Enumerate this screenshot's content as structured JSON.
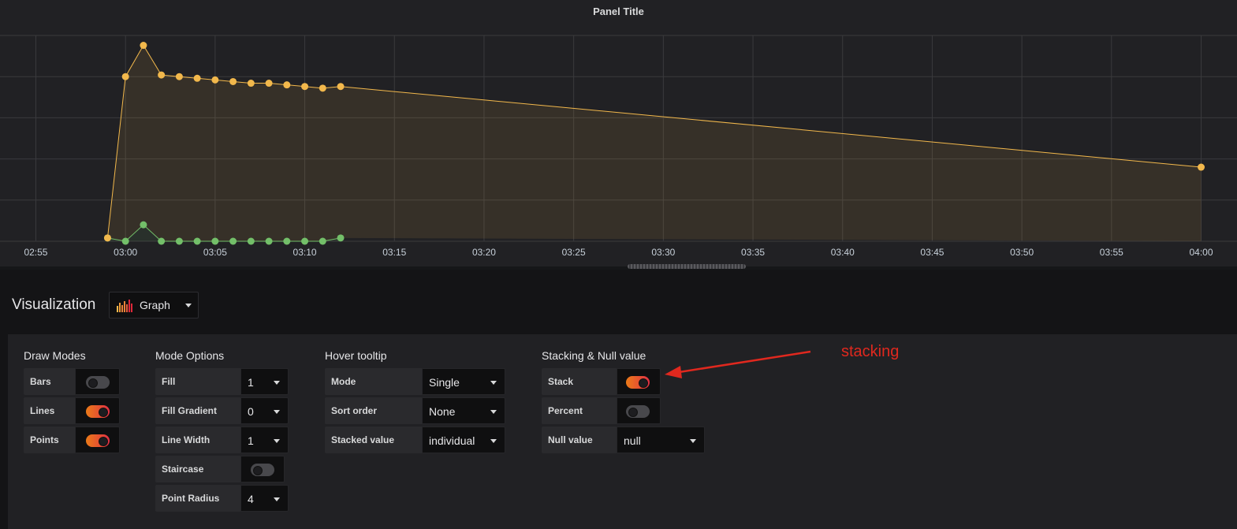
{
  "panel": {
    "title": "Panel Title"
  },
  "chart_data": {
    "type": "line",
    "x_ticks": [
      "02:55",
      "03:00",
      "03:05",
      "03:10",
      "03:15",
      "03:20",
      "03:25",
      "03:30",
      "03:35",
      "03:40",
      "03:45",
      "03:50",
      "03:55",
      "04:00"
    ],
    "x_domain": [
      "02:53",
      "04:02"
    ],
    "stacked": true,
    "fill": true,
    "points": true,
    "grid": true,
    "series": [
      {
        "color": "#73bf69",
        "points": [
          [
            "02:59",
            0.2
          ],
          [
            "03:00",
            0
          ],
          [
            "03:01",
            1.0
          ],
          [
            "03:02",
            0
          ],
          [
            "03:03",
            0
          ],
          [
            "03:04",
            0
          ],
          [
            "03:05",
            0
          ],
          [
            "03:06",
            0
          ],
          [
            "03:07",
            0
          ],
          [
            "03:08",
            0
          ],
          [
            "03:09",
            0
          ],
          [
            "03:10",
            0
          ],
          [
            "03:11",
            0
          ],
          [
            "03:12",
            0.2
          ]
        ]
      },
      {
        "color": "#f2b84c",
        "points": [
          [
            "02:59",
            0
          ],
          [
            "03:00",
            10.0
          ],
          [
            "03:01",
            10.9
          ],
          [
            "03:02",
            10.1
          ],
          [
            "03:03",
            10.0
          ],
          [
            "03:04",
            9.9
          ],
          [
            "03:05",
            9.8
          ],
          [
            "03:06",
            9.7
          ],
          [
            "03:07",
            9.6
          ],
          [
            "03:08",
            9.6
          ],
          [
            "03:09",
            9.5
          ],
          [
            "03:10",
            9.4
          ],
          [
            "03:11",
            9.3
          ],
          [
            "03:12",
            9.2
          ],
          [
            "04:00",
            4.5
          ]
        ]
      }
    ],
    "ylim": [
      0,
      12.5
    ]
  },
  "visualization": {
    "label": "Visualization",
    "selected": "Graph"
  },
  "annotation": "stacking",
  "sections": {
    "draw_modes": {
      "title": "Draw Modes",
      "rows": [
        {
          "label": "Bars",
          "on": false
        },
        {
          "label": "Lines",
          "on": true
        },
        {
          "label": "Points",
          "on": true
        }
      ]
    },
    "mode_options": {
      "title": "Mode Options",
      "fill": {
        "label": "Fill",
        "value": "1"
      },
      "fill_gradient": {
        "label": "Fill Gradient",
        "value": "0"
      },
      "line_width": {
        "label": "Line Width",
        "value": "1"
      },
      "staircase": {
        "label": "Staircase",
        "on": false
      },
      "point_radius": {
        "label": "Point Radius",
        "value": "4"
      }
    },
    "hover_tooltip": {
      "title": "Hover tooltip",
      "mode": {
        "label": "Mode",
        "value": "Single"
      },
      "sort_order": {
        "label": "Sort order",
        "value": "None"
      },
      "stacked_value": {
        "label": "Stacked value",
        "value": "individual"
      }
    },
    "stacking": {
      "title": "Stacking & Null value",
      "stack": {
        "label": "Stack",
        "on": true
      },
      "percent": {
        "label": "Percent",
        "on": false
      },
      "null_value": {
        "label": "Null value",
        "value": "null"
      }
    }
  }
}
